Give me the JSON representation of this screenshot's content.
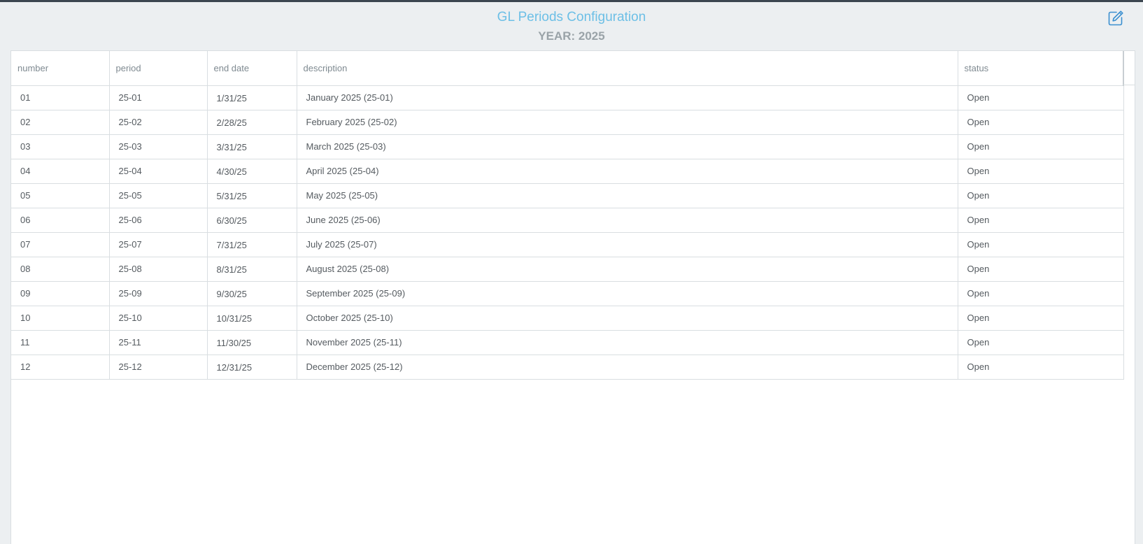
{
  "header": {
    "title": "GL Periods Configuration",
    "subtitle": "YEAR: 2025",
    "edit_icon": "edit-icon"
  },
  "colors": {
    "title": "#6cbfe6",
    "subtitle": "#9aa3a8",
    "edit_icon": "#3a8fd0"
  },
  "table": {
    "columns": [
      "number",
      "period",
      "end date",
      "description",
      "status"
    ],
    "rows": [
      {
        "number": "01",
        "period": "25-01",
        "end_date": "1/31/25",
        "description": "January 2025 (25-01)",
        "status": "Open"
      },
      {
        "number": "02",
        "period": "25-02",
        "end_date": "2/28/25",
        "description": "February 2025 (25-02)",
        "status": "Open"
      },
      {
        "number": "03",
        "period": "25-03",
        "end_date": "3/31/25",
        "description": "March 2025 (25-03)",
        "status": "Open"
      },
      {
        "number": "04",
        "period": "25-04",
        "end_date": "4/30/25",
        "description": "April 2025 (25-04)",
        "status": "Open"
      },
      {
        "number": "05",
        "period": "25-05",
        "end_date": "5/31/25",
        "description": "May 2025 (25-05)",
        "status": "Open"
      },
      {
        "number": "06",
        "period": "25-06",
        "end_date": "6/30/25",
        "description": "June 2025 (25-06)",
        "status": "Open"
      },
      {
        "number": "07",
        "period": "25-07",
        "end_date": "7/31/25",
        "description": "July 2025 (25-07)",
        "status": "Open"
      },
      {
        "number": "08",
        "period": "25-08",
        "end_date": "8/31/25",
        "description": "August 2025 (25-08)",
        "status": "Open"
      },
      {
        "number": "09",
        "period": "25-09",
        "end_date": "9/30/25",
        "description": "September 2025 (25-09)",
        "status": "Open"
      },
      {
        "number": "10",
        "period": "25-10",
        "end_date": "10/31/25",
        "description": "October 2025 (25-10)",
        "status": "Open"
      },
      {
        "number": "11",
        "period": "25-11",
        "end_date": "11/30/25",
        "description": "November 2025 (25-11)",
        "status": "Open"
      },
      {
        "number": "12",
        "period": "25-12",
        "end_date": "12/31/25",
        "description": "December 2025 (25-12)",
        "status": "Open"
      }
    ]
  }
}
